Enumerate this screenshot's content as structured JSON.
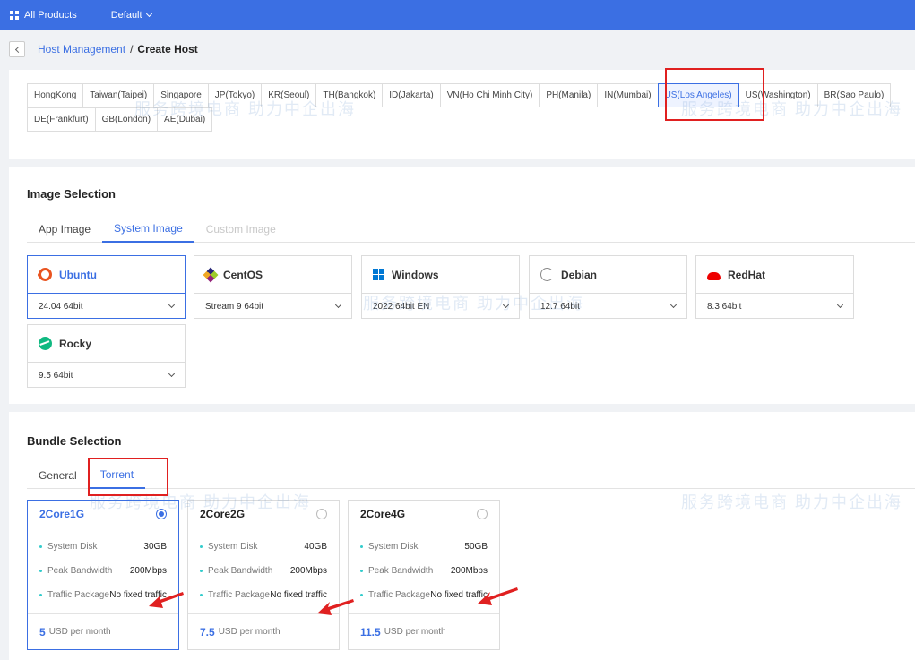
{
  "topbar": {
    "all_products": "All Products",
    "default_label": "Default"
  },
  "breadcrumb": {
    "parent": "Host Management",
    "separator": "/",
    "current": "Create Host"
  },
  "regions": {
    "row1": [
      "HongKong",
      "Taiwan(Taipei)",
      "Singapore",
      "JP(Tokyo)",
      "KR(Seoul)",
      "TH(Bangkok)",
      "ID(Jakarta)",
      "VN(Ho Chi Minh City)",
      "PH(Manila)",
      "IN(Mumbai)",
      "US(Los Angeles)",
      "US(Washington)",
      "BR(Sao Paulo)"
    ],
    "row2": [
      "DE(Frankfurt)",
      "GB(London)",
      "AE(Dubai)"
    ],
    "selected": "US(Los Angeles)"
  },
  "image_selection": {
    "title": "Image Selection",
    "tabs": [
      "App Image",
      "System Image",
      "Custom Image"
    ],
    "active_tab": "System Image",
    "os": [
      {
        "name": "Ubuntu",
        "version": "24.04 64bit",
        "icon": "ubuntu-icon"
      },
      {
        "name": "CentOS",
        "version": "Stream 9 64bit",
        "icon": "centos-icon"
      },
      {
        "name": "Windows",
        "version": "2022 64bit EN",
        "icon": "windows-icon"
      },
      {
        "name": "Debian",
        "version": "12.7 64bit",
        "icon": "debian-icon"
      },
      {
        "name": "RedHat",
        "version": "8.3 64bit",
        "icon": "redhat-icon"
      },
      {
        "name": "Rocky",
        "version": "9.5 64bit",
        "icon": "rocky-icon"
      }
    ],
    "selected_os": "Ubuntu"
  },
  "bundle_selection": {
    "title": "Bundle Selection",
    "tabs": [
      "General",
      "Torrent"
    ],
    "active_tab": "Torrent",
    "spec_labels": {
      "disk": "System Disk",
      "bandwidth": "Peak Bandwidth",
      "traffic": "Traffic Package"
    },
    "bundles": [
      {
        "name": "2Core1G",
        "disk": "30GB",
        "bandwidth": "200Mbps",
        "traffic": "No fixed traffic",
        "price": "5",
        "unit": "USD per month"
      },
      {
        "name": "2Core2G",
        "disk": "40GB",
        "bandwidth": "200Mbps",
        "traffic": "No fixed traffic",
        "price": "7.5",
        "unit": "USD per month"
      },
      {
        "name": "2Core4G",
        "disk": "50GB",
        "bandwidth": "200Mbps",
        "traffic": "No fixed traffic",
        "price": "11.5",
        "unit": "USD per month"
      }
    ],
    "selected_bundle": "2Core1G"
  },
  "watermark": {
    "text": "服务跨境电商 助力中企出海"
  },
  "colors": {
    "accent": "#3b6fe3",
    "highlight": "#e02020"
  }
}
